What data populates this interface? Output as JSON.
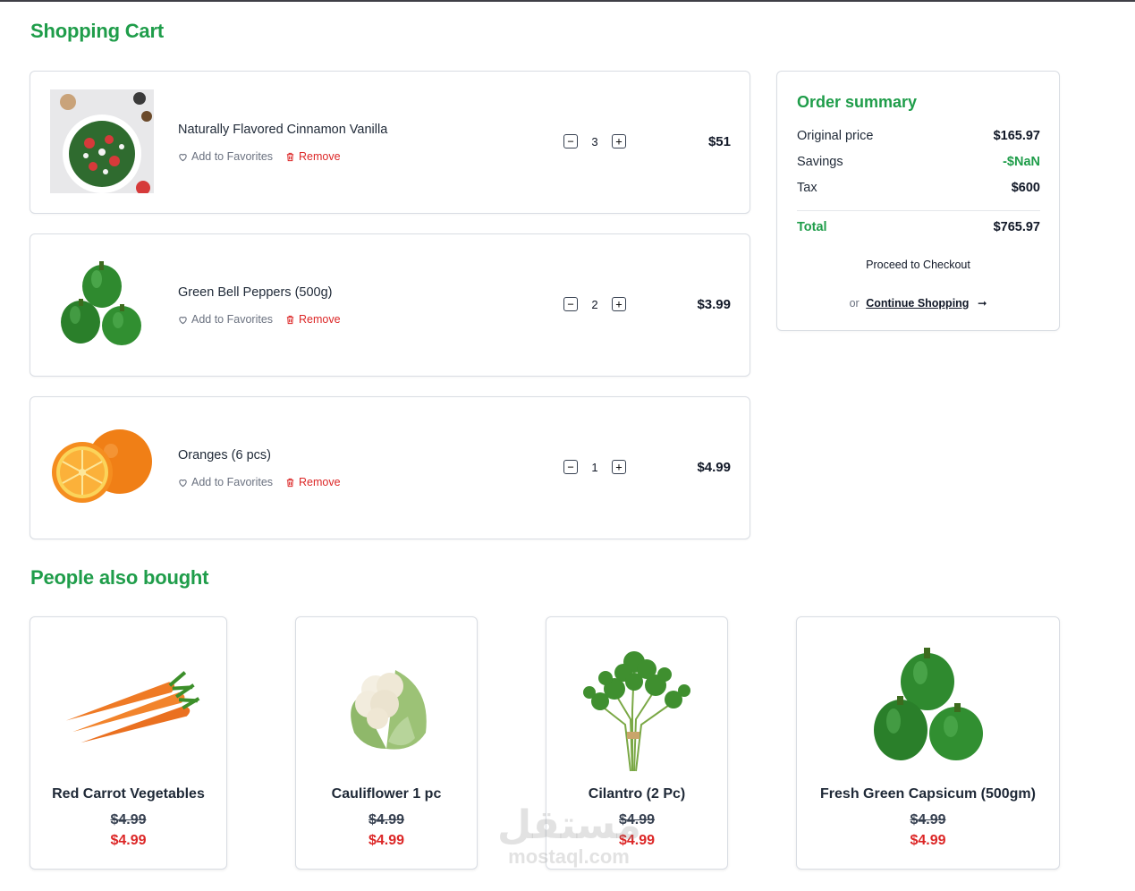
{
  "page": {
    "title": "Shopping Cart",
    "also_bought_title": "People also bought"
  },
  "cart": {
    "items": [
      {
        "name": "Naturally Flavored Cinnamon Vanilla",
        "quantity": "3",
        "price": "$51",
        "favorite_label": "Add to Favorites",
        "remove_label": "Remove",
        "image": "salad-bowl-image"
      },
      {
        "name": "Green Bell Peppers (500g)",
        "quantity": "2",
        "price": "$3.99",
        "favorite_label": "Add to Favorites",
        "remove_label": "Remove",
        "image": "green-peppers-image"
      },
      {
        "name": "Oranges (6 pcs)",
        "quantity": "1",
        "price": "$4.99",
        "favorite_label": "Add to Favorites",
        "remove_label": "Remove",
        "image": "oranges-image"
      }
    ],
    "decrement_symbol": "−",
    "increment_symbol": "+"
  },
  "summary": {
    "title": "Order summary",
    "original_price_label": "Original price",
    "original_price": "$165.97",
    "savings_label": "Savings",
    "savings": "-$NaN",
    "tax_label": "Tax",
    "tax": "$600",
    "total_label": "Total",
    "total": "$765.97",
    "checkout_label": "Proceed to Checkout",
    "or_label": "or",
    "continue_label": "Continue Shopping",
    "arrow": "➞"
  },
  "also_bought": [
    {
      "name": "Red Carrot Vegetables",
      "old_price": "$4.99",
      "new_price": "$4.99",
      "image": "carrots-image"
    },
    {
      "name": "Cauliflower 1 pc",
      "old_price": "$4.99",
      "new_price": "$4.99",
      "image": "cauliflower-image"
    },
    {
      "name": "Cilantro (2 Pc)",
      "old_price": "$4.99",
      "new_price": "$4.99",
      "image": "cilantro-image"
    },
    {
      "name": "Fresh Green Capsicum (500gm)",
      "old_price": "$4.99",
      "new_price": "$4.99",
      "image": "capsicum-image"
    }
  ],
  "watermark": {
    "arabic": "مستقل",
    "latin": "mostaql.com"
  },
  "colors": {
    "accent_green": "#1f9d4a",
    "remove_red": "#dc2626",
    "border": "#d9dde3"
  }
}
